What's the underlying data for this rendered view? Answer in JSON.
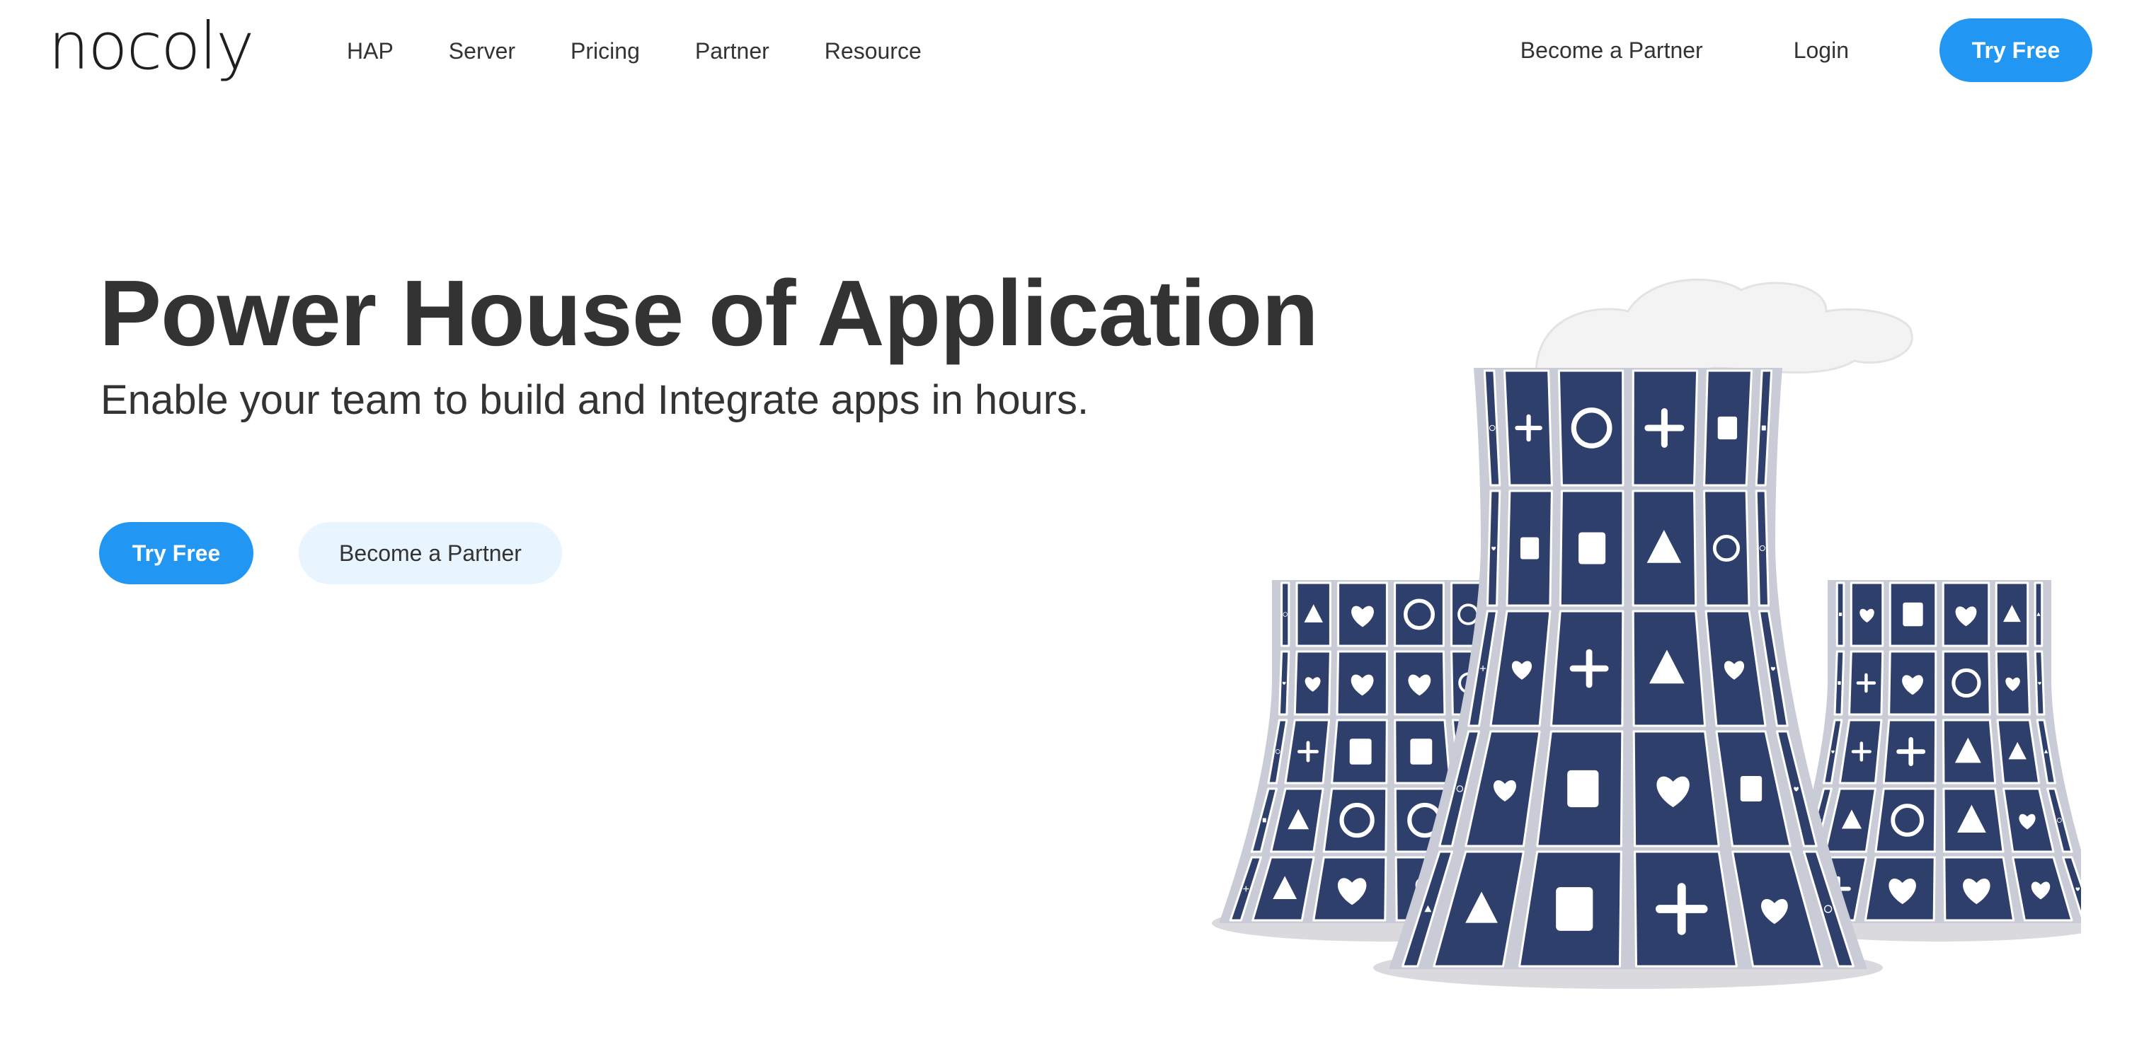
{
  "header": {
    "logo": "nocoly",
    "nav": [
      "HAP",
      "Server",
      "Pricing",
      "Partner",
      "Resource"
    ],
    "become_partner": "Become a Partner",
    "login": "Login",
    "try_free": "Try Free"
  },
  "hero": {
    "title": "Power House of Application",
    "subtitle": "Enable your team to build and Integrate apps in hours.",
    "try_free": "Try Free",
    "become_partner": "Become a Partner"
  },
  "theme": {
    "accent": "#2196f3",
    "secondary_bg": "#e8f4fe",
    "tile_color": "#2f3f6c",
    "text": "#333333"
  },
  "illustration": {
    "icons": [
      "globe-icon",
      "person-icon",
      "gear-icon",
      "music-icon",
      "store-icon",
      "map-pin-icon",
      "palm-tree-icon",
      "grid-icon",
      "cart-icon",
      "info-icon",
      "trash-icon",
      "toolbox-icon",
      "cloud-icon",
      "compass-icon",
      "dog-icon",
      "sun-icon",
      "megaphone-icon",
      "armchair-icon",
      "bug-icon",
      "helmet-icon",
      "robot-icon",
      "heart-icon",
      "qr-code-icon",
      "bell-icon",
      "factory-icon",
      "dollar-icon",
      "pie-chart-icon",
      "bar-chart-icon",
      "alarm-icon",
      "user-icon",
      "calendar-icon",
      "mail-icon",
      "document-icon",
      "checkmark-icon",
      "folder-icon",
      "pencil-icon",
      "bookmark-icon",
      "presentation-icon",
      "scan-icon",
      "flashlight-icon",
      "lightbulb-icon",
      "plus-icon",
      "atom-icon",
      "barcode-icon",
      "warning-icon",
      "shapes-icon",
      "family-icon",
      "smiley-icon",
      "film-icon",
      "runner-icon"
    ]
  }
}
